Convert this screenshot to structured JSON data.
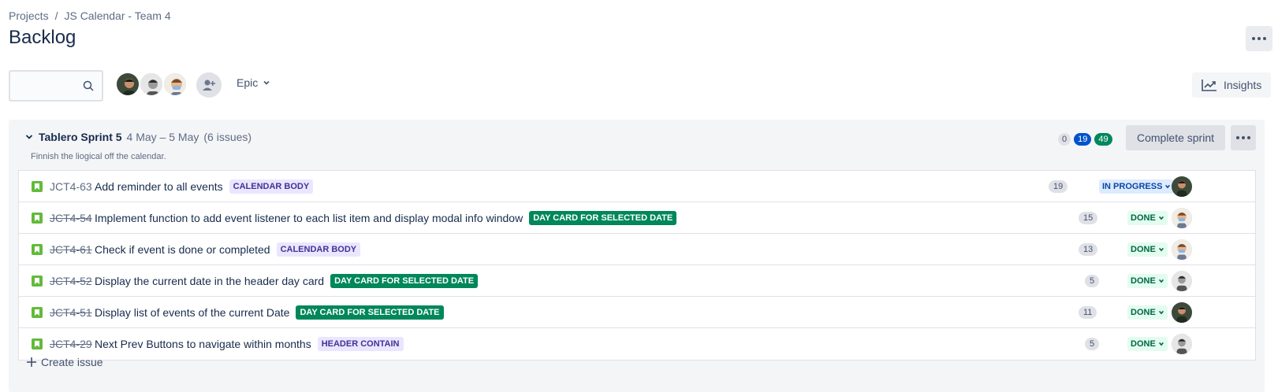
{
  "breadcrumb": {
    "items": [
      "Projects",
      "JS Calendar - Team 4"
    ],
    "separator": "/"
  },
  "page": {
    "title": "Backlog"
  },
  "filters": {
    "search_placeholder": "",
    "epic_label": "Epic",
    "insights_label": "Insights"
  },
  "sprint": {
    "name": "Tablero Sprint 5",
    "dates": "4 May – 5 May",
    "issue_count": "(6 issues)",
    "goal": "Finnish the liogical off the calendar.",
    "counts": {
      "todo": "0",
      "in_progress": "19",
      "done": "49"
    },
    "complete_label": "Complete sprint",
    "issues": [
      {
        "key": "JCT4-63",
        "summary": "Add reminder to all events",
        "epic": "CALENDAR BODY",
        "epic_color": "purple",
        "points": "19",
        "status": "IN PROGRESS",
        "status_type": "inprogress",
        "done": false,
        "assignee": "avatar-1"
      },
      {
        "key": "JCT4-54",
        "summary": "Implement function to add event listener to each list item and display modal info window",
        "epic": "DAY CARD FOR SELECTED DATE",
        "epic_color": "green",
        "points": "15",
        "status": "DONE",
        "status_type": "done",
        "done": true,
        "assignee": "avatar-3"
      },
      {
        "key": "JCT4-61",
        "summary": "Check if event is done or completed",
        "epic": "CALENDAR BODY",
        "epic_color": "purple",
        "points": "13",
        "status": "DONE",
        "status_type": "done",
        "done": true,
        "assignee": "avatar-3"
      },
      {
        "key": "JCT4-52",
        "summary": "Display the current date in the header day card",
        "epic": "DAY CARD FOR SELECTED DATE",
        "epic_color": "green",
        "points": "5",
        "status": "DONE",
        "status_type": "done",
        "done": true,
        "assignee": "avatar-2"
      },
      {
        "key": "JCT4-51",
        "summary": "Display list of events of the current Date",
        "epic": "DAY CARD FOR SELECTED DATE",
        "epic_color": "green",
        "points": "11",
        "status": "DONE",
        "status_type": "done",
        "done": true,
        "assignee": "avatar-1"
      },
      {
        "key": "JCT4-29",
        "summary": "Next Prev Buttons to navigate within months",
        "epic": "HEADER CONTAIN",
        "epic_color": "purple",
        "points": "5",
        "status": "DONE",
        "status_type": "done",
        "done": true,
        "assignee": "avatar-2"
      }
    ],
    "create_issue_label": "Create issue"
  },
  "colors": {
    "primary_text": "#172b4d",
    "secondary_text": "#5e6c84",
    "in_progress": "#0052cc",
    "done": "#00875a",
    "story_icon": "#63ba3c"
  }
}
